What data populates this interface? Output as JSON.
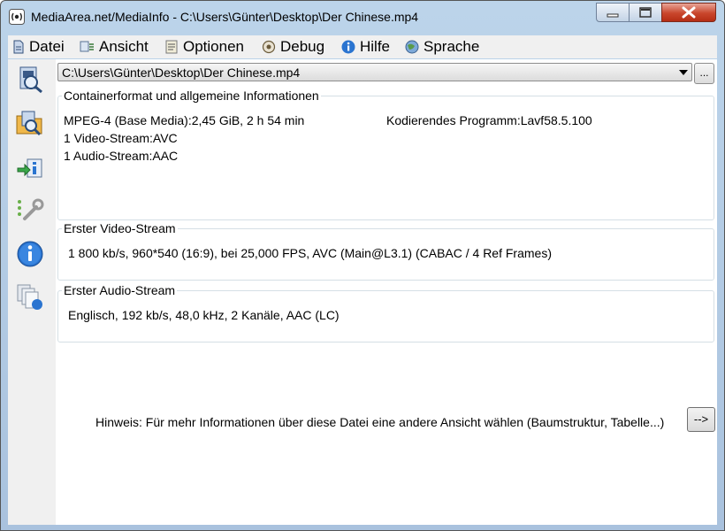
{
  "window": {
    "title": "MediaArea.net/MediaInfo - C:\\Users\\Günter\\Desktop\\Der Chinese.mp4"
  },
  "menu": {
    "items": [
      {
        "label": "Datei",
        "icon": "file-icon"
      },
      {
        "label": "Ansicht",
        "icon": "view-icon"
      },
      {
        "label": "Optionen",
        "icon": "options-icon"
      },
      {
        "label": "Debug",
        "icon": "debug-icon"
      },
      {
        "label": "Hilfe",
        "icon": "help-icon"
      },
      {
        "label": "Sprache",
        "icon": "language-icon"
      }
    ]
  },
  "sidebar": {
    "buttons": [
      "open-file-icon",
      "open-folder-icon",
      "export-icon",
      "preferences-icon",
      "about-icon",
      "check-updates-icon"
    ]
  },
  "file_selector": {
    "value": "C:\\Users\\Günter\\Desktop\\Der Chinese.mp4",
    "browse_label": "..."
  },
  "general": {
    "legend": "Containerformat und allgemeine Informationen",
    "format_line": "MPEG-4 (Base Media):2,45 GiB, 2 h 54 min",
    "encoder_line": "Kodierendes Programm:Lavf58.5.100",
    "video_count": "1 Video-Stream:AVC",
    "audio_count": "1 Audio-Stream:AAC"
  },
  "video": {
    "legend": "Erster Video-Stream",
    "summary": "1 800 kb/s, 960*540 (16:9), bei 25,000 FPS, AVC (Main@L3.1) (CABAC / 4 Ref Frames)"
  },
  "audio": {
    "legend": "Erster Audio-Stream",
    "summary": "Englisch, 192 kb/s, 48,0 kHz, 2 Kanäle, AAC (LC)"
  },
  "hint": {
    "text": "Hinweis: Für mehr Informationen über diese Datei eine andere Ansicht wählen (Baumstruktur, Tabelle...)",
    "button": "-->"
  },
  "colors": {
    "accent": "#1f6fd0",
    "close_button": "#c9462c",
    "titlebar": "#b8d0e8"
  }
}
